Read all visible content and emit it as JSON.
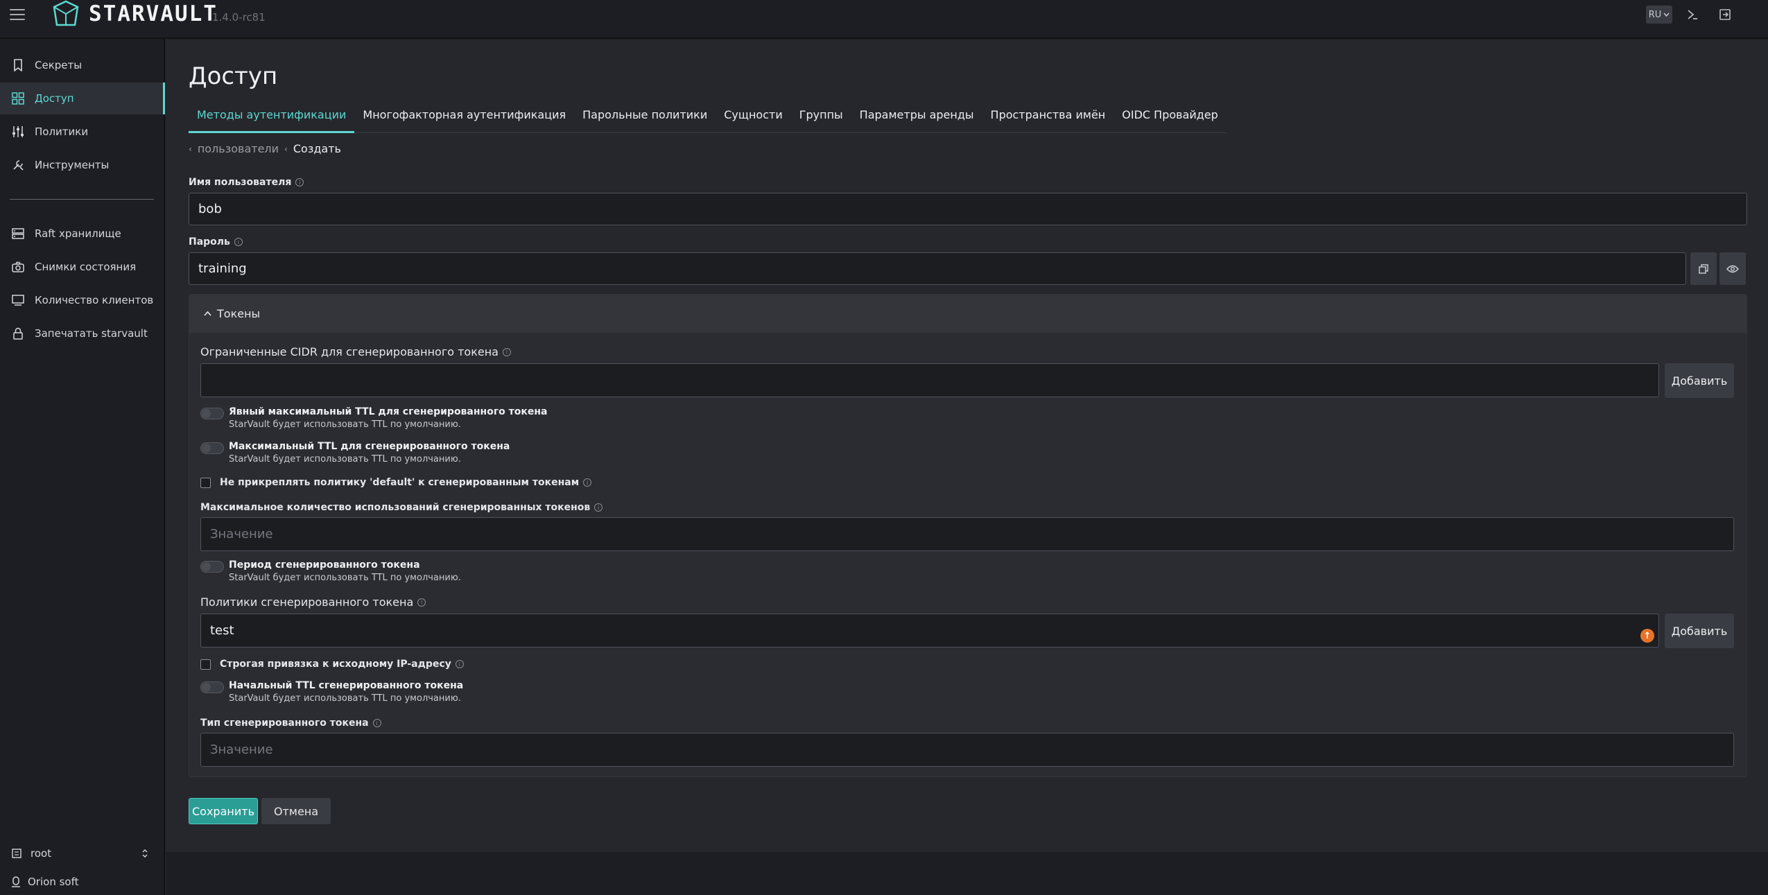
{
  "app": {
    "name": "STARVAULT",
    "version": "1.4.0-rc81",
    "lang": "RU"
  },
  "sidebar": {
    "items": [
      {
        "label": "Секреты",
        "icon": "bookmark-icon"
      },
      {
        "label": "Доступ",
        "icon": "grid-icon"
      },
      {
        "label": "Политики",
        "icon": "sliders-icon"
      },
      {
        "label": "Инструменты",
        "icon": "tools-icon"
      },
      {
        "label": "Raft хранилище",
        "icon": "server-icon"
      },
      {
        "label": "Снимки состояния",
        "icon": "camera-icon"
      },
      {
        "label": "Количество клиентов",
        "icon": "monitor-icon"
      },
      {
        "label": "Запечатать starvault",
        "icon": "lock-icon"
      }
    ],
    "namespace": "root",
    "org": "Orion soft"
  },
  "page": {
    "title": "Доступ",
    "tabs": [
      "Методы аутентификации",
      "Многофакторная аутентификация",
      "Парольные политики",
      "Сущности",
      "Группы",
      "Параметры аренды",
      "Пространства имён",
      "OIDC Провайдер"
    ],
    "breadcrumb": {
      "parent": "пользователи",
      "current": "Создать"
    }
  },
  "form": {
    "username_label": "Имя пользователя",
    "username_value": "bob",
    "password_label": "Пароль",
    "password_value": "training",
    "tokens_section": "Токены",
    "cidr_label": "Ограниченные CIDR для сгенерированного токена",
    "add_label": "Добавить",
    "explicit_max_ttl_label": "Явный максимальный TTL для сгенерированного токена",
    "default_ttl_hint": "StarVault будет использовать TTL по умолчанию.",
    "max_ttl_label": "Максимальный TTL для сгенерированного токена",
    "no_default_policy_label": "Не прикреплять политику 'default' к сгенерированным токенам",
    "max_uses_label": "Максимальное количество использований сгенерированных токенов",
    "value_placeholder": "Значение",
    "period_label": "Период сгенерированного токена",
    "policies_label": "Политики сгенерированного токена",
    "policies_value": "test",
    "strict_ip_label": "Строгая привязка к исходному IP-адресу",
    "initial_ttl_label": "Начальный TTL сгенерированного токена",
    "token_type_label": "Тип сгенерированного токена",
    "save_label": "Сохранить",
    "cancel_label": "Отмена"
  }
}
